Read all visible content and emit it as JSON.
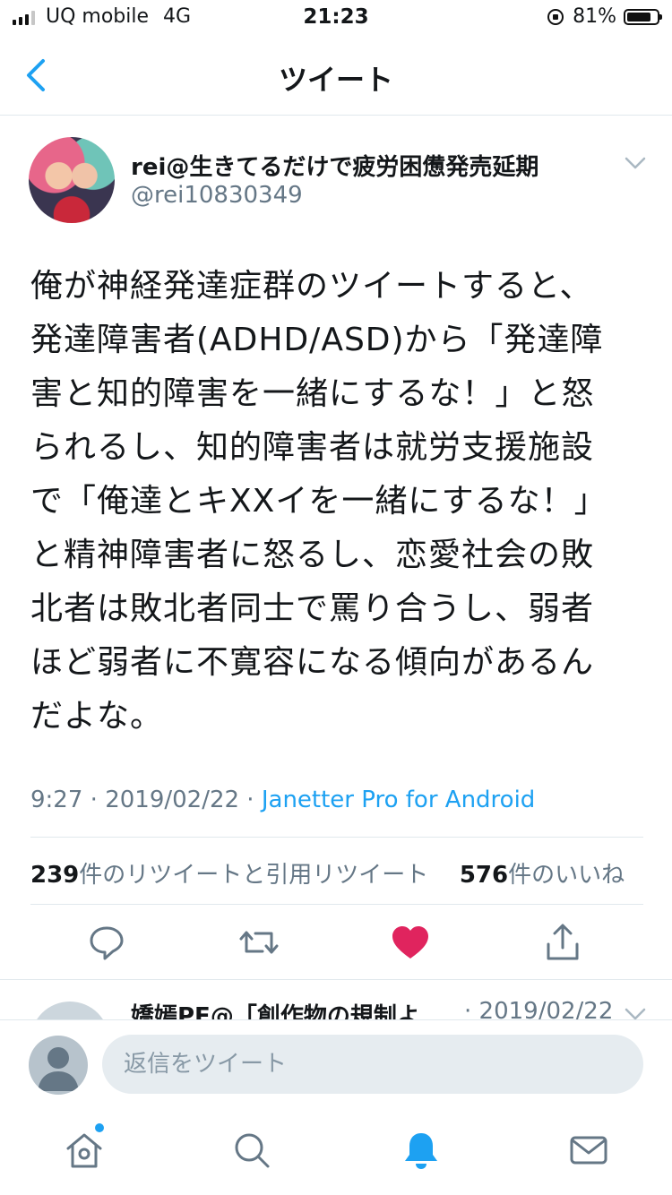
{
  "status_bar": {
    "carrier": "UQ mobile",
    "network": "4G",
    "time": "21:23",
    "battery": "81%",
    "battery_level": 0.81
  },
  "header": {
    "title": "ツイート",
    "back_icon": "chevron-left-icon"
  },
  "tweet": {
    "display_name": "rei@生きてるだけで疲労困憊発売延期",
    "handle": "@rei10830349",
    "text": "俺が神経発達症群のツイートすると、\n発達障害者(ADHD/ASD)から「発達障\n害と知的障害を一緒にするな！」と怒\nられるし、知的障害者は就労支援施設\nで「俺達とキXXイを一緒にするな！」\nと精神障害者に怒るし、恋愛社会の敗\n北者は敗北者同士で罵り合うし、弱者\nほど弱者に不寛容になる傾向があるん\nだよな。",
    "time": "9:27",
    "date": "2019/02/22",
    "separator": " · ",
    "client": "Janetter Pro for Android",
    "retweet_count": "239",
    "retweet_label": "件のリツイートと引用リツイート",
    "like_count": "576",
    "like_label": "件のいいね",
    "liked": true
  },
  "reply_preview": {
    "name": "嬌嫣PF@「創作物の規制よ…",
    "date": "· 2019/02/22"
  },
  "composer": {
    "placeholder": "返信をツイート"
  },
  "tabbar": {
    "items": [
      "home-icon",
      "search-icon",
      "notifications-icon",
      "messages-icon"
    ],
    "active": "notifications-icon"
  },
  "colors": {
    "accent": "#1da1f2",
    "like": "#e0245e",
    "muted": "#657786",
    "text": "#14171a"
  }
}
